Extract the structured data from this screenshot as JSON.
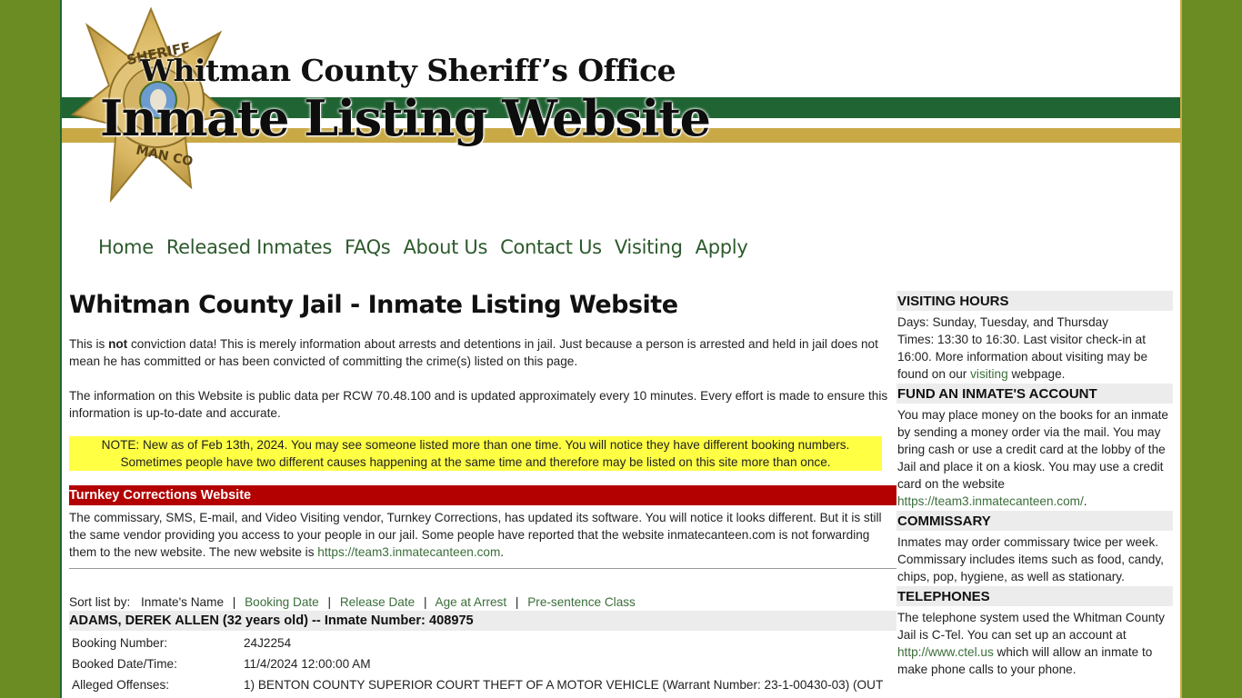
{
  "banner": {
    "line1": "Whitman County Sheriff’s Office",
    "line2": "Inmate Listing Website",
    "badge_icon": "sheriff-star-badge-icon",
    "colors": {
      "green": "#206433",
      "gold": "#c8a945",
      "background": "#6a8c22"
    }
  },
  "nav": {
    "items": [
      {
        "label": "Home"
      },
      {
        "label": "Released Inmates"
      },
      {
        "label": "FAQs"
      },
      {
        "label": "About Us"
      },
      {
        "label": "Contact Us"
      },
      {
        "label": "Visiting"
      },
      {
        "label": "Apply"
      }
    ]
  },
  "main": {
    "title": "Whitman County Jail - Inmate Listing Website",
    "disclaimer": {
      "prefix": "This is ",
      "bold": "not",
      "suffix": " conviction data! This is merely information about arrests and detentions in jail. Just because a person is arrested and held in jail does not mean he has committed or has been convicted of committing the crime(s) listed on this page."
    },
    "public_data": "The information on this Website is public data per RCW 70.48.100 and is updated approximately every 10 minutes. Every effort is made to ensure this information is up-to-date and accurate.",
    "note": "NOTE: New as of Feb 13th, 2024. You may see someone listed more than one time. You will notice they have different booking numbers. Sometimes people have two different causes happening at the same time and therefore may be listed on this site more than once.",
    "turnkey": {
      "heading": "Turnkey Corrections Website",
      "text": "The commissary, SMS, E-mail, and Video Visiting vendor, Turnkey Corrections, has updated its software. You will notice it looks different. But it is still the same vendor providing you access to your people in our jail. Some people have reported that the website inmatecanteen.com is not forwarding them to the new website. The new website is ",
      "link": "https://team3.inmatecanteen.com",
      "after": "."
    },
    "sort": {
      "label": "Sort list by:",
      "current": "Inmate's Name",
      "options": [
        "Booking Date",
        "Release Date",
        "Age at Arrest",
        "Pre-sentence Class"
      ]
    },
    "inmates": [
      {
        "header": "ADAMS, DEREK ALLEN (32 years old) -- Inmate Number: 408975",
        "fields": [
          {
            "label": "Booking Number:",
            "value": "24J2254"
          },
          {
            "label": "Booked Date/Time:",
            "value": "11/4/2024 12:00:00 AM"
          },
          {
            "label": "Alleged Offenses:",
            "value": "1) BENTON COUNTY SUPERIOR COURT THEFT OF A MOTOR VEHICLE (Warrant Number: 23-1-00430-03) (OUT"
          }
        ]
      }
    ]
  },
  "sidebar": {
    "visiting": {
      "heading": "VISITING HOURS",
      "days": "Days: Sunday, Tuesday, and Thursday",
      "times_before": "Times: 13:30 to 16:30. Last visitor check-in at 16:00. More information about visiting may be found on our ",
      "link": "visiting",
      "times_after": " webpage."
    },
    "fund": {
      "heading": "FUND AN INMATE'S ACCOUNT",
      "text": "You may place money on the books for an inmate by sending a money order via the mail. You may bring cash or use a credit card at the lobby of the Jail and place it on a kiosk. You may use a credit card on the website ",
      "link": "https://team3.inmatecanteen.com/",
      "after": "."
    },
    "commissary": {
      "heading": "COMMISSARY",
      "text": "Inmates may order commissary twice per week. Commissary includes items such as food, candy, chips, pop, hygiene, as well as stationary."
    },
    "telephones": {
      "heading": "TELEPHONES",
      "before": "The telephone system used the Whitman County Jail is C-Tel. You can set up an account at ",
      "link": "http://www.ctel.us",
      "after": " which will allow an inmate to make phone calls to your phone."
    }
  }
}
